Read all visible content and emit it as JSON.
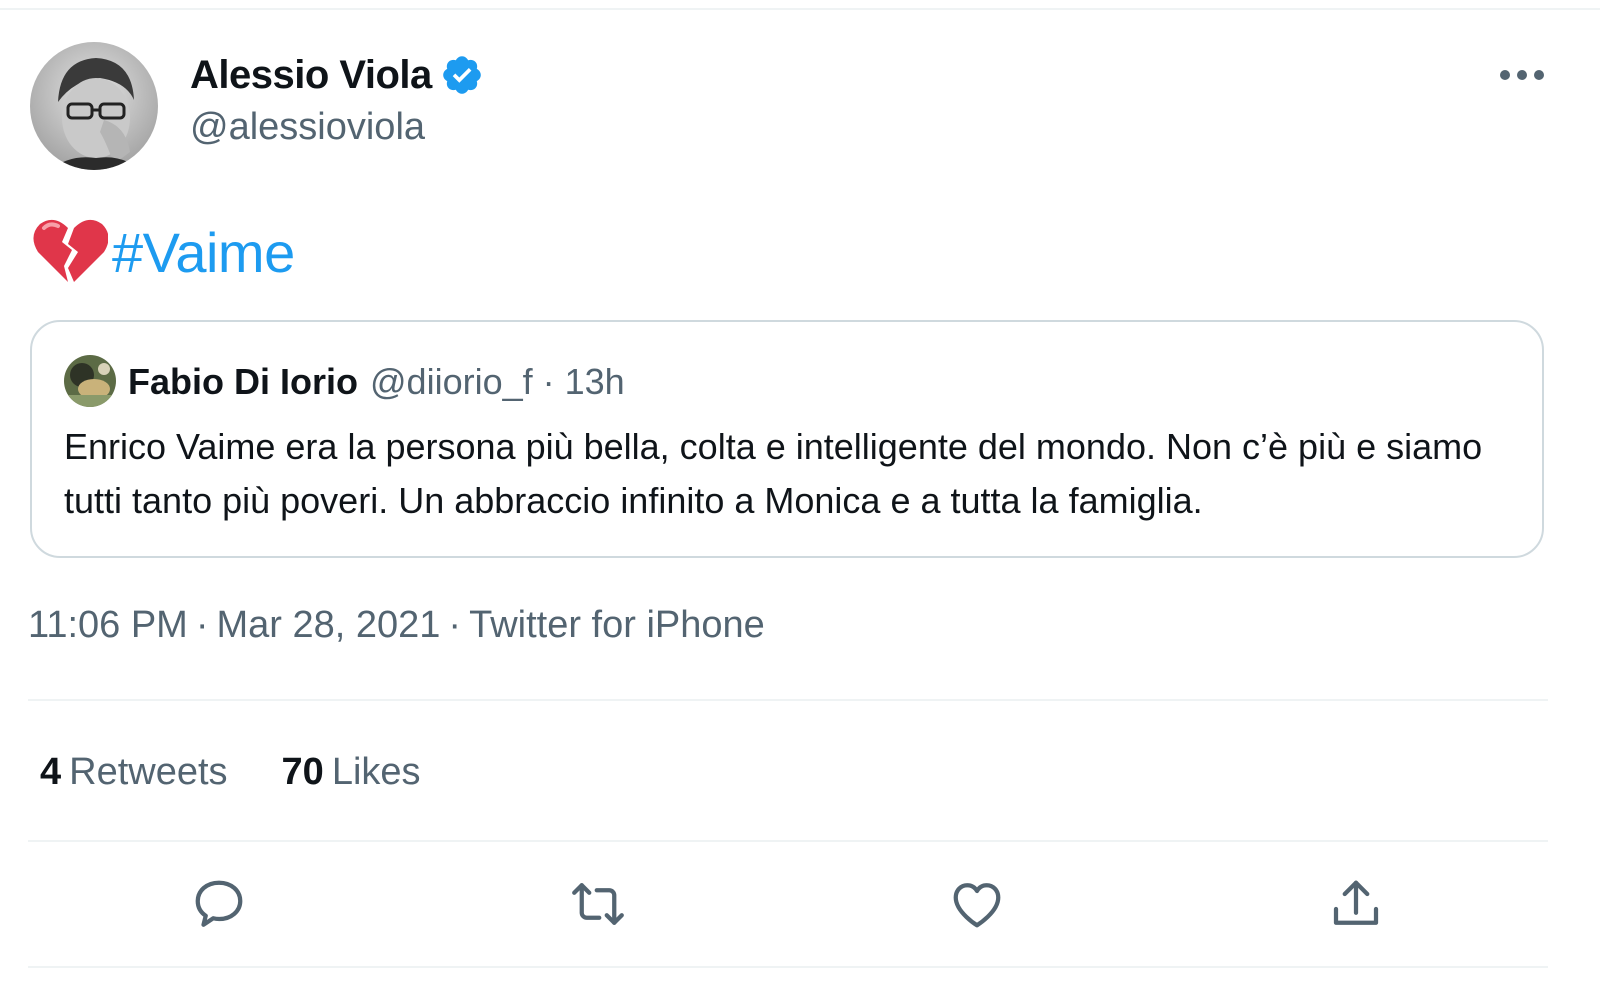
{
  "tweet": {
    "author": {
      "name": "Alessio Viola",
      "handle": "@alessioviola",
      "verified": true
    },
    "text": {
      "emoji": "broken-heart",
      "hashtag": "#Vaime"
    },
    "quoted": {
      "name": "Fabio Di Iorio",
      "handle": "@diiorio_f",
      "separator": "·",
      "time": "13h",
      "body": "Enrico Vaime era la persona più bella, colta e intelligente del mondo. Non c’è più e siamo tutti tanto più poveri. Un abbraccio infinito a Monica e a tutta la famiglia."
    },
    "meta": {
      "time": "11:06 PM",
      "date": "Mar 28, 2021",
      "source": "Twitter for iPhone",
      "separator": "·"
    },
    "stats": {
      "retweets_count": "4",
      "retweets_label": "Retweets",
      "likes_count": "70",
      "likes_label": "Likes"
    },
    "actions": [
      "reply-icon",
      "retweet-icon",
      "like-icon",
      "share-icon"
    ]
  },
  "colors": {
    "accent": "#1d9bf0",
    "text": "#0f1419",
    "secondary": "#536471",
    "border": "#cfd9de",
    "emoji_red": "#e0364a"
  }
}
